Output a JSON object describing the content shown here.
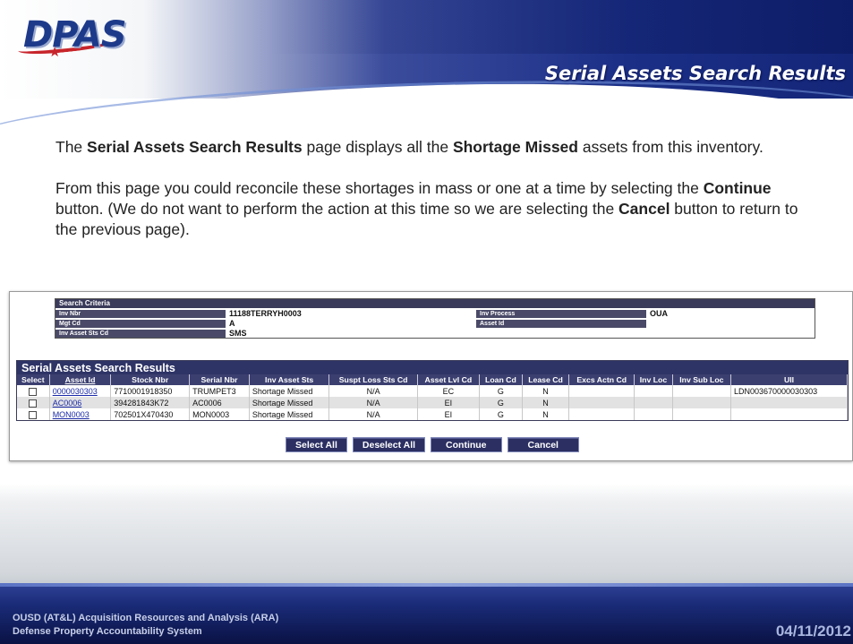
{
  "header": {
    "logo_text": "DPAS",
    "page_title": "Serial Assets Search Results"
  },
  "intro": {
    "p1_a": "The ",
    "p1_b": "Serial Assets Search Results",
    "p1_c": " page displays all the ",
    "p1_d": "Shortage Missed",
    "p1_e": " assets from this inventory.",
    "p2_a": "From this page you could reconcile these shortages in mass or one at a time by selecting the ",
    "p2_b": "Continue",
    "p2_c": " button. (We do not want  to perform the action at this time so we are selecting the ",
    "p2_d": "Cancel",
    "p2_e": " button to return to the previous page)."
  },
  "criteria": {
    "title": "Search Criteria",
    "inv_nbr_label": "Inv Nbr",
    "inv_nbr_value": "11188TERRYH0003",
    "inv_process_label": "Inv Process",
    "inv_process_value": "OUA",
    "mgt_cd_label": "Mgt Cd",
    "mgt_cd_value": "A",
    "asset_id_label": "Asset Id",
    "asset_id_value": "",
    "inv_asset_sts_label": "Inv Asset Sts Cd",
    "inv_asset_sts_value": "SMS"
  },
  "results": {
    "title": "Serial Assets Search Results",
    "columns": [
      "Select",
      "Asset Id",
      "Stock Nbr",
      "Serial Nbr",
      "Inv Asset Sts",
      "Suspt Loss Sts Cd",
      "Asset Lvl Cd",
      "Loan Cd",
      "Lease Cd",
      "Excs Actn Cd",
      "Inv Loc",
      "Inv Sub Loc",
      "UII"
    ],
    "rows": [
      {
        "asset_id": "0000030303",
        "stock_nbr": "7710001918350",
        "serial_nbr": "TRUMPET3",
        "inv_asset_sts": "Shortage Missed",
        "suspt_loss": "N/A",
        "asset_lvl": "EC",
        "loan": "G",
        "lease": "N",
        "excs": "",
        "inv_loc": "",
        "inv_sub_loc": "",
        "uii": "LDN003670000030303"
      },
      {
        "asset_id": "AC0006",
        "stock_nbr": "394281843K72",
        "serial_nbr": "AC0006",
        "inv_asset_sts": "Shortage Missed",
        "suspt_loss": "N/A",
        "asset_lvl": "EI",
        "loan": "G",
        "lease": "N",
        "excs": "",
        "inv_loc": "",
        "inv_sub_loc": "",
        "uii": ""
      },
      {
        "asset_id": "MON0003",
        "stock_nbr": "702501X470430",
        "serial_nbr": "MON0003",
        "inv_asset_sts": "Shortage Missed",
        "suspt_loss": "N/A",
        "asset_lvl": "EI",
        "loan": "G",
        "lease": "N",
        "excs": "",
        "inv_loc": "",
        "inv_sub_loc": "",
        "uii": ""
      }
    ]
  },
  "buttons": {
    "select_all": "Select All",
    "deselect_all": "Deselect All",
    "continue": "Continue",
    "cancel": "Cancel"
  },
  "footer": {
    "org_line1": "OUSD (AT&L) Acquisition Resources and Analysis (ARA)",
    "org_line2": "Defense Property Accountability System",
    "date": "04/11/2012"
  }
}
